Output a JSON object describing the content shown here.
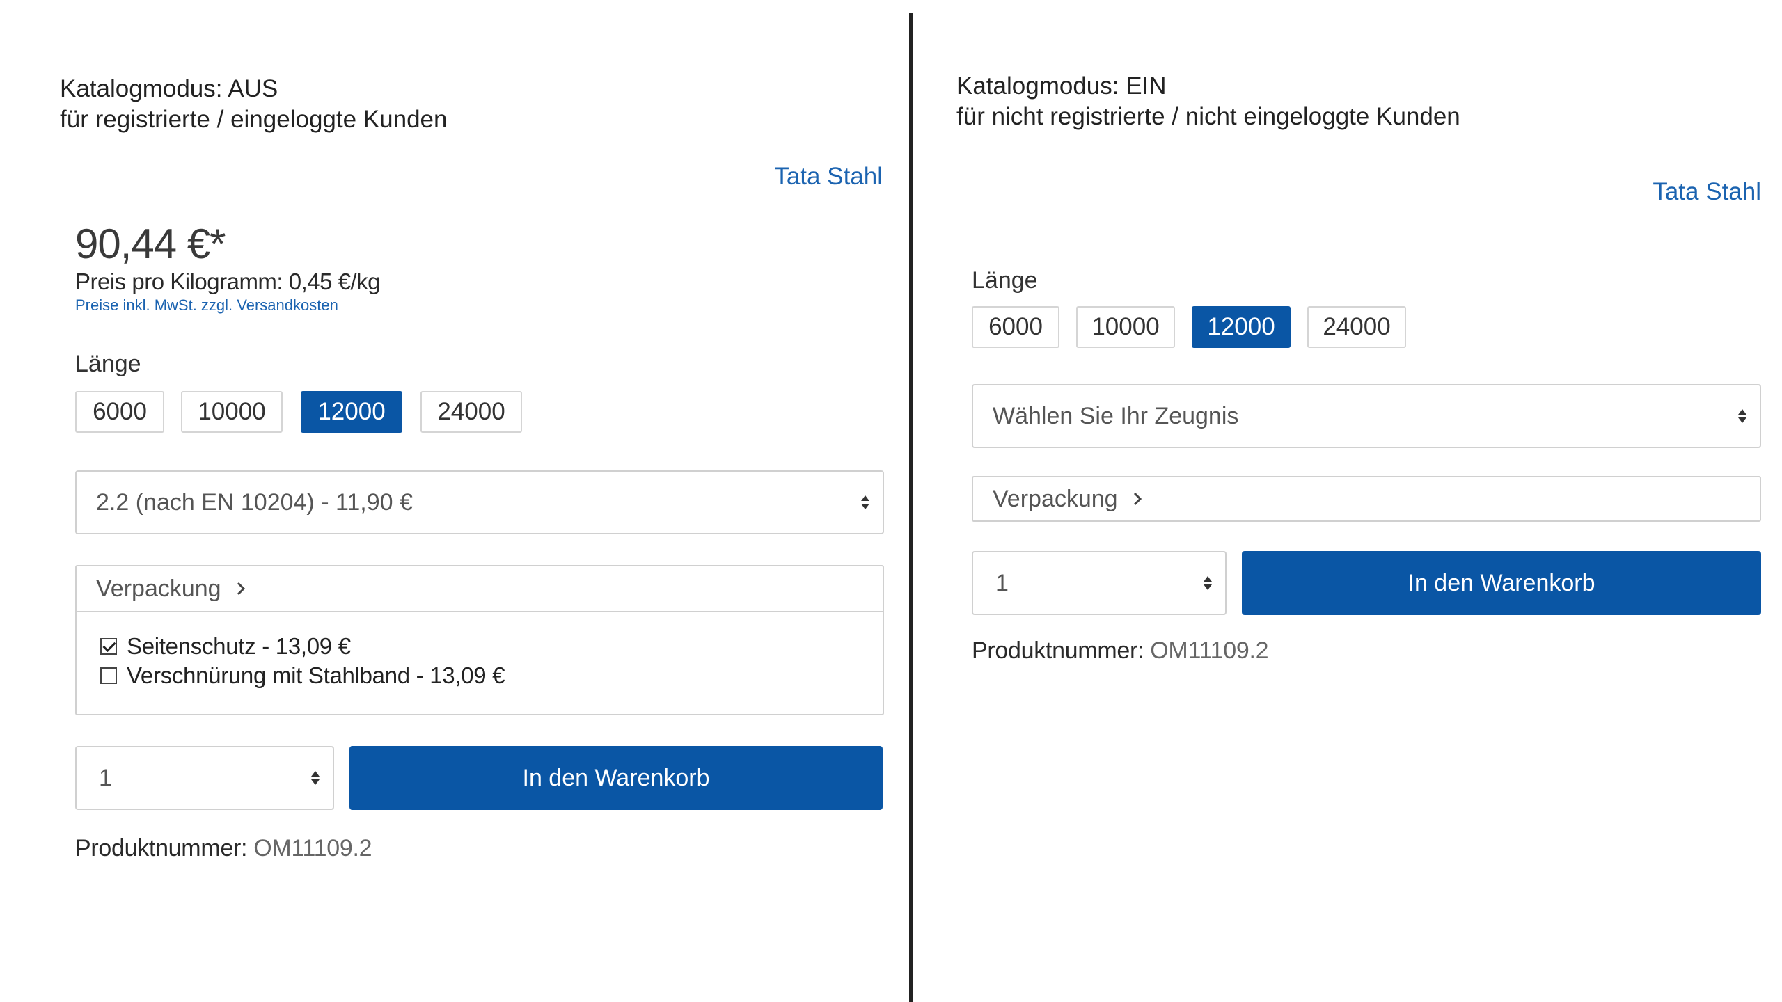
{
  "left": {
    "caption_line1": "Katalogmodus: AUS",
    "caption_line2": "für registrierte / eingeloggte Kunden",
    "brand": "Tata Stahl",
    "price": "90,44 €*",
    "unit_price": "Preis pro Kilogramm: 0,45 €/kg",
    "tax_note": "Preise inkl. MwSt. zzgl. Versandkosten",
    "length_label": "Länge",
    "length_options": [
      "6000",
      "10000",
      "12000",
      "24000"
    ],
    "selected_length": "12000",
    "certificate_select": "2.2 (nach EN 10204) - 11,90 €",
    "packaging_label": "Verpackung",
    "packaging_options": [
      {
        "label": "Seitenschutz - 13,09 €",
        "checked": true
      },
      {
        "label": "Verschnürung mit Stahlband - 13,09 €",
        "checked": false
      }
    ],
    "quantity": "1",
    "cart_button": "In den Warenkorb",
    "product_number_label": "Produktnummer:",
    "product_number": "OM11109.2"
  },
  "right": {
    "caption_line1": "Katalogmodus: EIN",
    "caption_line2": "für nicht registrierte / nicht eingeloggte Kunden",
    "brand": "Tata Stahl",
    "length_label": "Länge",
    "length_options": [
      "6000",
      "10000",
      "12000",
      "24000"
    ],
    "selected_length": "12000",
    "certificate_select": "Wählen Sie Ihr Zeugnis",
    "packaging_label": "Verpackung",
    "quantity": "1",
    "cart_button": "In den Warenkorb",
    "product_number_label": "Produktnummer:",
    "product_number": "OM11109.2"
  },
  "colors": {
    "accent": "#0a56a5",
    "link": "#1b63b0",
    "border": "#d0d0d0"
  },
  "icons": {
    "select": "select-arrows-icon",
    "packaging": "chevron-right-icon",
    "checkbox": "checkbox-icon"
  }
}
